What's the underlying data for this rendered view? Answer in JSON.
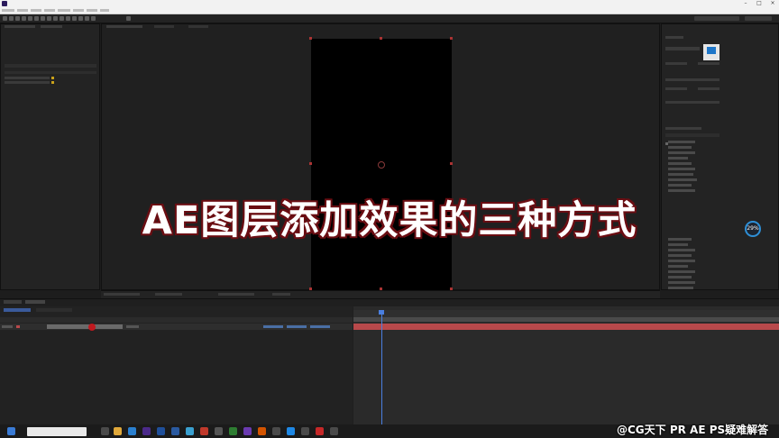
{
  "overlay": {
    "title": "AE图层添加效果的三种方式",
    "watermark": "@CG天下 PR AE PS疑难解答"
  },
  "performance": {
    "cpu_percent": "29%"
  },
  "colors": {
    "layer_bar": "#b8494b",
    "playhead": "#4a7fe0",
    "comp_canvas": "#000000",
    "overlay_stroke": "#6a0d12"
  }
}
